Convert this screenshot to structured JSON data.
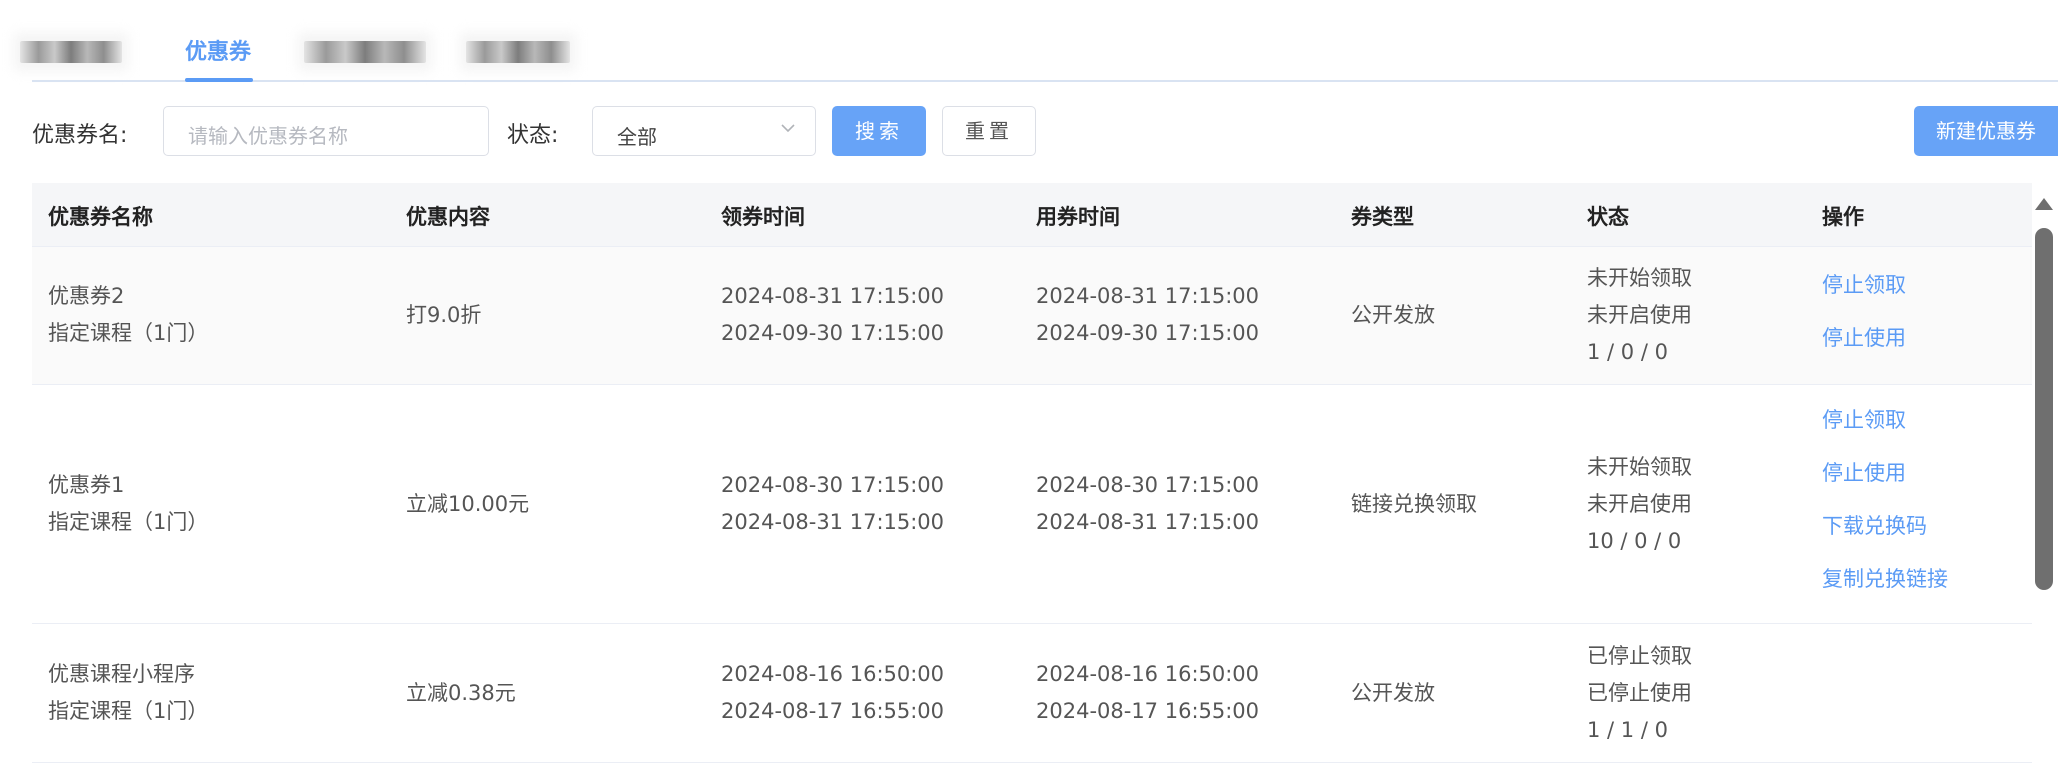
{
  "tabs": {
    "active_label": "优惠券"
  },
  "filters": {
    "name_label": "优惠券名:",
    "name_placeholder": "请输入优惠券名称",
    "status_label": "状态:",
    "status_value": "全部",
    "search_label": "搜索",
    "reset_label": "重置",
    "new_coupon_label": "新建优惠券"
  },
  "table": {
    "headers": {
      "name": "优惠券名称",
      "content": "优惠内容",
      "claim_time": "领券时间",
      "use_time": "用券时间",
      "type": "券类型",
      "status": "状态",
      "actions": "操作"
    },
    "rows": [
      {
        "name": "优惠券2",
        "scope": "指定课程（1门）",
        "content": "打9.0折",
        "claim_start": "2024-08-31 17:15:00",
        "claim_end": "2024-09-30 17:15:00",
        "use_start": "2024-08-31 17:15:00",
        "use_end": "2024-09-30 17:15:00",
        "type": "公开发放",
        "status_claim": "未开始领取",
        "status_use": "未开启使用",
        "counts": "1 / 0 / 0",
        "actions": [
          "停止领取",
          "停止使用"
        ]
      },
      {
        "name": "优惠券1",
        "scope": "指定课程（1门）",
        "content": "立减10.00元",
        "claim_start": "2024-08-30 17:15:00",
        "claim_end": "2024-08-31 17:15:00",
        "use_start": "2024-08-30 17:15:00",
        "use_end": "2024-08-31 17:15:00",
        "type": "链接兑换领取",
        "status_claim": "未开始领取",
        "status_use": "未开启使用",
        "counts": "10 / 0 / 0",
        "actions": [
          "停止领取",
          "停止使用",
          "下载兑换码",
          "复制兑换链接"
        ]
      },
      {
        "name": "优惠课程小程序",
        "scope": "指定课程（1门）",
        "content": "立减0.38元",
        "claim_start": "2024-08-16 16:50:00",
        "claim_end": "2024-08-17 16:55:00",
        "use_start": "2024-08-16 16:50:00",
        "use_end": "2024-08-17 16:55:00",
        "type": "公开发放",
        "status_claim": "已停止领取",
        "status_use": "已停止使用",
        "counts": "1 / 1 / 0",
        "actions": []
      }
    ]
  },
  "colors": {
    "accent": "#5b9bf5",
    "button_primary": "#67a3f7",
    "header_bg": "#f5f6f8"
  },
  "icons": {
    "select_arrow": "chevron-down-icon",
    "scroll_up": "caret-up-icon"
  }
}
